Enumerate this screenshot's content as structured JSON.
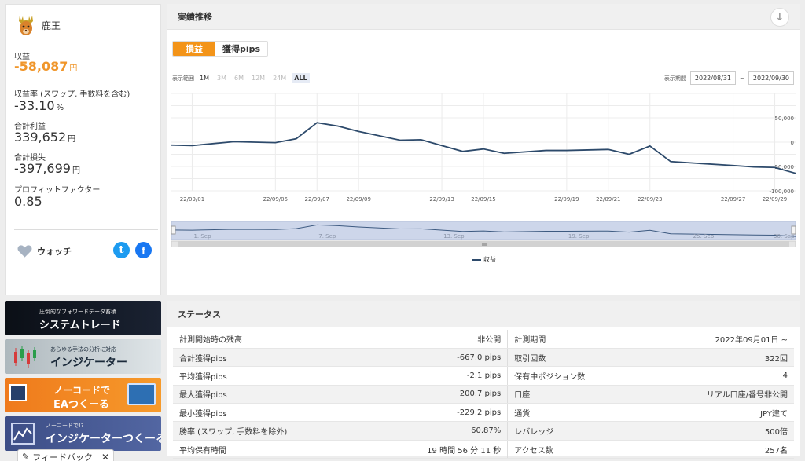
{
  "profile": {
    "name": "鹿王",
    "profit_label": "収益",
    "profit_value": "-58,087",
    "profit_unit": "円",
    "return_label": "収益率 (スワップ, 手数料を含む)",
    "return_value": "-33.10",
    "return_unit": "%",
    "total_profit_label": "合計利益",
    "total_profit_value": "339,652",
    "total_loss_label": "合計損失",
    "total_loss_value": "-397,699",
    "yen_unit": "円",
    "pf_label": "プロフィットファクター",
    "pf_value": "0.85",
    "watch_label": "ウォッチ",
    "twitter_glyph": "t",
    "facebook_glyph": "f"
  },
  "banners": [
    {
      "sub": "圧倒的なフォワードデータ蓄積",
      "main": "システムトレード"
    },
    {
      "sub": "あらゆる手法の分析に対応",
      "main": "インジケーター"
    },
    {
      "sub": "ノーコードで",
      "main": "EAつくーる"
    },
    {
      "sub": "ノーコードで!?",
      "main": "インジケーターつくーる"
    }
  ],
  "feedback": {
    "label": "フィードバック",
    "close": "✕"
  },
  "chart_panel": {
    "title": "実績推移",
    "download_glyph": "↓",
    "tab_profit": "損益",
    "tab_pips": "獲得pips",
    "range_label": "表示範囲",
    "range_buttons": [
      "1M",
      "3M",
      "6M",
      "12M",
      "24M",
      "ALL"
    ],
    "period_label": "表示期間",
    "period_start": "2022/08/31",
    "period_sep": "~",
    "period_end": "2022/09/30",
    "legend": "収益"
  },
  "chart_data": {
    "type": "line",
    "title": "",
    "series": [
      {
        "name": "収益",
        "color": "#2d4a6b",
        "x": [
          "22/08/31",
          "22/09/01",
          "22/09/03",
          "22/09/05",
          "22/09/06",
          "22/09/07",
          "22/09/08",
          "22/09/09",
          "22/09/11",
          "22/09/12",
          "22/09/14",
          "22/09/15",
          "22/09/16",
          "22/09/18",
          "22/09/19",
          "22/09/21",
          "22/09/22",
          "22/09/23",
          "22/09/24",
          "22/09/27",
          "22/09/28",
          "22/09/29",
          "22/09/30"
        ],
        "values": [
          -6000,
          -7000,
          1000,
          -1000,
          7000,
          40000,
          33000,
          22000,
          4000,
          5000,
          -19000,
          -14000,
          -23000,
          -17000,
          -17000,
          -15000,
          -25000,
          -8000,
          -40000,
          -48000,
          -51000,
          -52000,
          -64000
        ]
      }
    ],
    "xticks": [
      "22/09/01",
      "22/09/05",
      "22/09/07",
      "22/09/09",
      "22/09/13",
      "22/09/15",
      "22/09/19",
      "22/09/21",
      "22/09/23",
      "22/09/27",
      "22/09/29"
    ],
    "yticks": [
      "50,000",
      "0",
      "-50,000",
      "-100,000"
    ],
    "ylim": [
      -100000,
      100000
    ],
    "navigator_labels": [
      "1. Sep",
      "7. Sep",
      "13. Sep",
      "19. Sep",
      "25. Sep",
      "30. Sep"
    ],
    "grid": true,
    "legend_position": "bottom-center"
  },
  "status": {
    "title": "ステータス",
    "rows": [
      {
        "l1": "計測開始時の残高",
        "v1": "非公開",
        "l2": "計測期間",
        "v2": "2022年09月01日 ~"
      },
      {
        "l1": "合計獲得pips",
        "v1": "-667.0 pips",
        "l2": "取引回数",
        "v2": "322回"
      },
      {
        "l1": "平均獲得pips",
        "v1": "-2.1 pips",
        "l2": "保有中ポジション数",
        "v2": "4"
      },
      {
        "l1": "最大獲得pips",
        "v1": "200.7 pips",
        "l2": "口座",
        "v2": "リアル口座/番号非公開"
      },
      {
        "l1": "最小獲得pips",
        "v1": "-229.2 pips",
        "l2": "通貨",
        "v2": "JPY建て"
      },
      {
        "l1": "勝率 (スワップ, 手数料を除外)",
        "v1": "60.87%",
        "l2": "レバレッジ",
        "v2": "500倍"
      },
      {
        "l1": "平均保有時間",
        "v1": "19 時間 56 分 11 秒",
        "l2": "アクセス数",
        "v2": "257名"
      }
    ]
  }
}
